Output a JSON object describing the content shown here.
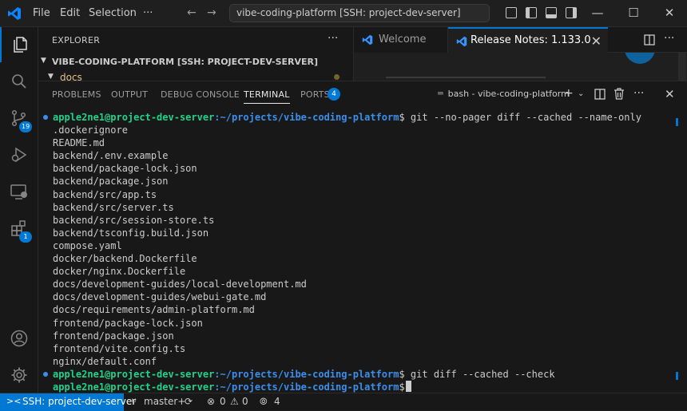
{
  "menu": {
    "file": "File",
    "edit": "Edit",
    "selection": "Selection",
    "more": "···"
  },
  "command_center": {
    "text": "vibe-coding-platform [SSH: project-dev-server]"
  },
  "activity_bar": {
    "source_control_badge": "19",
    "extensions_badge": "1"
  },
  "explorer": {
    "title": "EXPLORER",
    "more": "···",
    "root_folder": "VIBE-CODING-PLATFORM [SSH: PROJECT-DEV-SERVER]",
    "first_child": "docs"
  },
  "editor_tabs": [
    {
      "label": "Welcome"
    },
    {
      "label": "Release Notes: 1.133.0"
    }
  ],
  "panel": {
    "tabs": [
      {
        "label": "PROBLEMS"
      },
      {
        "label": "OUTPUT"
      },
      {
        "label": "DEBUG CONSOLE"
      },
      {
        "label": "TERMINAL"
      },
      {
        "label": "PORTS"
      }
    ],
    "ports_count": "4",
    "terminal_name": "bash - vibe-coding-platform"
  },
  "terminal": {
    "user_host": "apple2ne1@project-dev-server",
    "cwd": ":~/projects/vibe-coding-platform",
    "cmd1": "$ git --no-pager diff --cached --name-only",
    "output": [
      ".dockerignore",
      "README.md",
      "backend/.env.example",
      "backend/package-lock.json",
      "backend/package.json",
      "backend/src/app.ts",
      "backend/src/server.ts",
      "backend/src/session-store.ts",
      "backend/tsconfig.build.json",
      "compose.yaml",
      "docker/backend.Dockerfile",
      "docker/nginx.Dockerfile",
      "docs/development-guides/local-development.md",
      "docs/development-guides/webui-gate.md",
      "docs/requirements/admin-platform.md",
      "frontend/package-lock.json",
      "frontend/package.json",
      "frontend/vite.config.ts",
      "nginx/default.conf"
    ],
    "cmd2": "$ git diff --cached --check",
    "cmd3": "$"
  },
  "status_bar": {
    "remote": "SSH: project-dev-server",
    "branch": "master+",
    "errors": "0",
    "warnings": "0",
    "ports": "4"
  },
  "colors": {
    "accent": "#0078d4",
    "user": "#23d18b",
    "path": "#3b8eea"
  }
}
